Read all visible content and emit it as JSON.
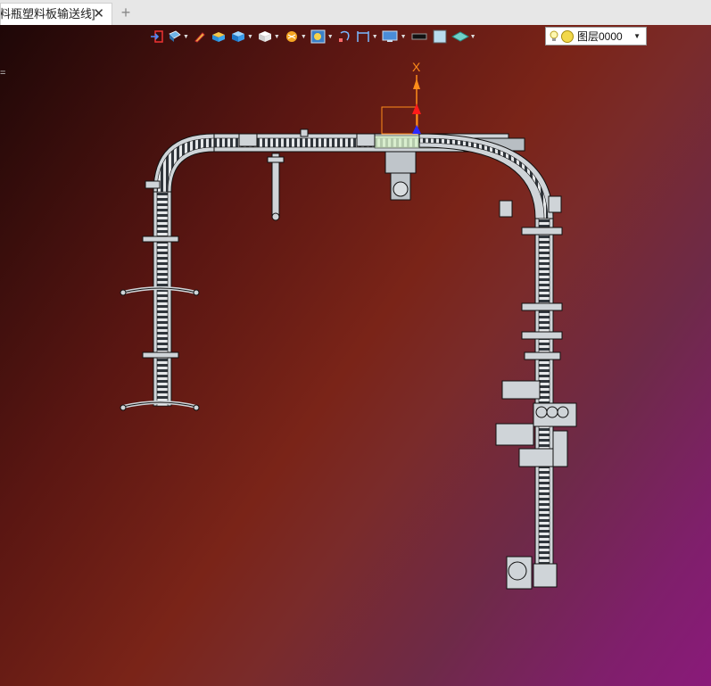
{
  "tab": {
    "title": "料瓶塑料板输送线]",
    "close_glyph": "✕",
    "new_tab_glyph": "+"
  },
  "toolbar": {
    "icons": [
      "exit-icon",
      "view-icon",
      "pencil-icon",
      "solid-box-icon",
      "blue-cube-icon",
      "white-cube-icon",
      "render-icon",
      "zoom-frame-icon",
      "snap-icon",
      "dimension-icon",
      "monitor-icon",
      "black-rect-icon",
      "light-blue-square-icon",
      "layer-plane-icon"
    ]
  },
  "layer": {
    "name": "图层0000",
    "dropdown_glyph": "▼"
  },
  "side_text": "=",
  "axis": {
    "label": "X",
    "color": "#ff8c1a"
  },
  "colors": {
    "viewport_top_left": "#1e0707",
    "viewport_bottom_right": "#8a1a7a",
    "conveyor": "#d9dde0",
    "conveyor_outline": "#1b1f24"
  }
}
